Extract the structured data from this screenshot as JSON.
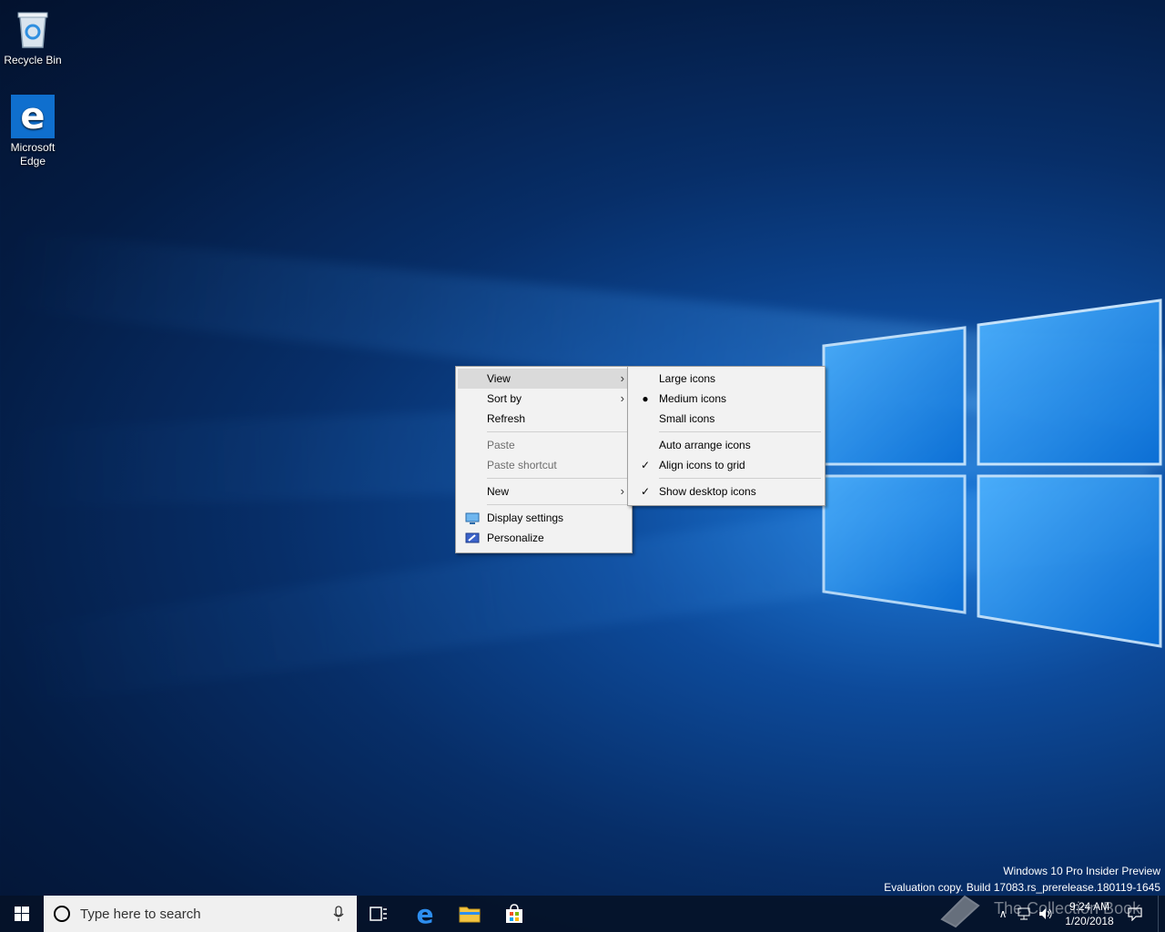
{
  "desktop": {
    "icons": [
      {
        "label": "Recycle Bin"
      },
      {
        "label": "Microsoft Edge"
      }
    ],
    "watermark_line1": "Windows 10 Pro Insider Preview",
    "watermark_line2": "Evaluation copy. Build 17083.rs_prerelease.180119-1645",
    "overlay_text": "The Collection Book"
  },
  "context_menu": {
    "items": [
      {
        "label": "View"
      },
      {
        "label": "Sort by"
      },
      {
        "label": "Refresh"
      },
      {
        "label": "Paste"
      },
      {
        "label": "Paste shortcut"
      },
      {
        "label": "New"
      },
      {
        "label": "Display settings"
      },
      {
        "label": "Personalize"
      }
    ]
  },
  "view_submenu": {
    "items": [
      {
        "label": "Large icons",
        "selected": false
      },
      {
        "label": "Medium icons",
        "selected": true
      },
      {
        "label": "Small icons",
        "selected": false
      },
      {
        "label": "Auto arrange icons",
        "checked": false
      },
      {
        "label": "Align icons to grid",
        "checked": true
      },
      {
        "label": "Show desktop icons",
        "checked": true
      }
    ]
  },
  "taskbar": {
    "search_placeholder": "Type here to search",
    "time": "9:24 AM",
    "date": "1/20/2018",
    "pinned": [
      "task-view-icon",
      "edge-icon",
      "file-explorer-icon",
      "store-icon"
    ]
  },
  "colors": {
    "accent": "#0078d7",
    "menu_bg": "#f2f2f2",
    "menu_highlight": "#dadada"
  }
}
